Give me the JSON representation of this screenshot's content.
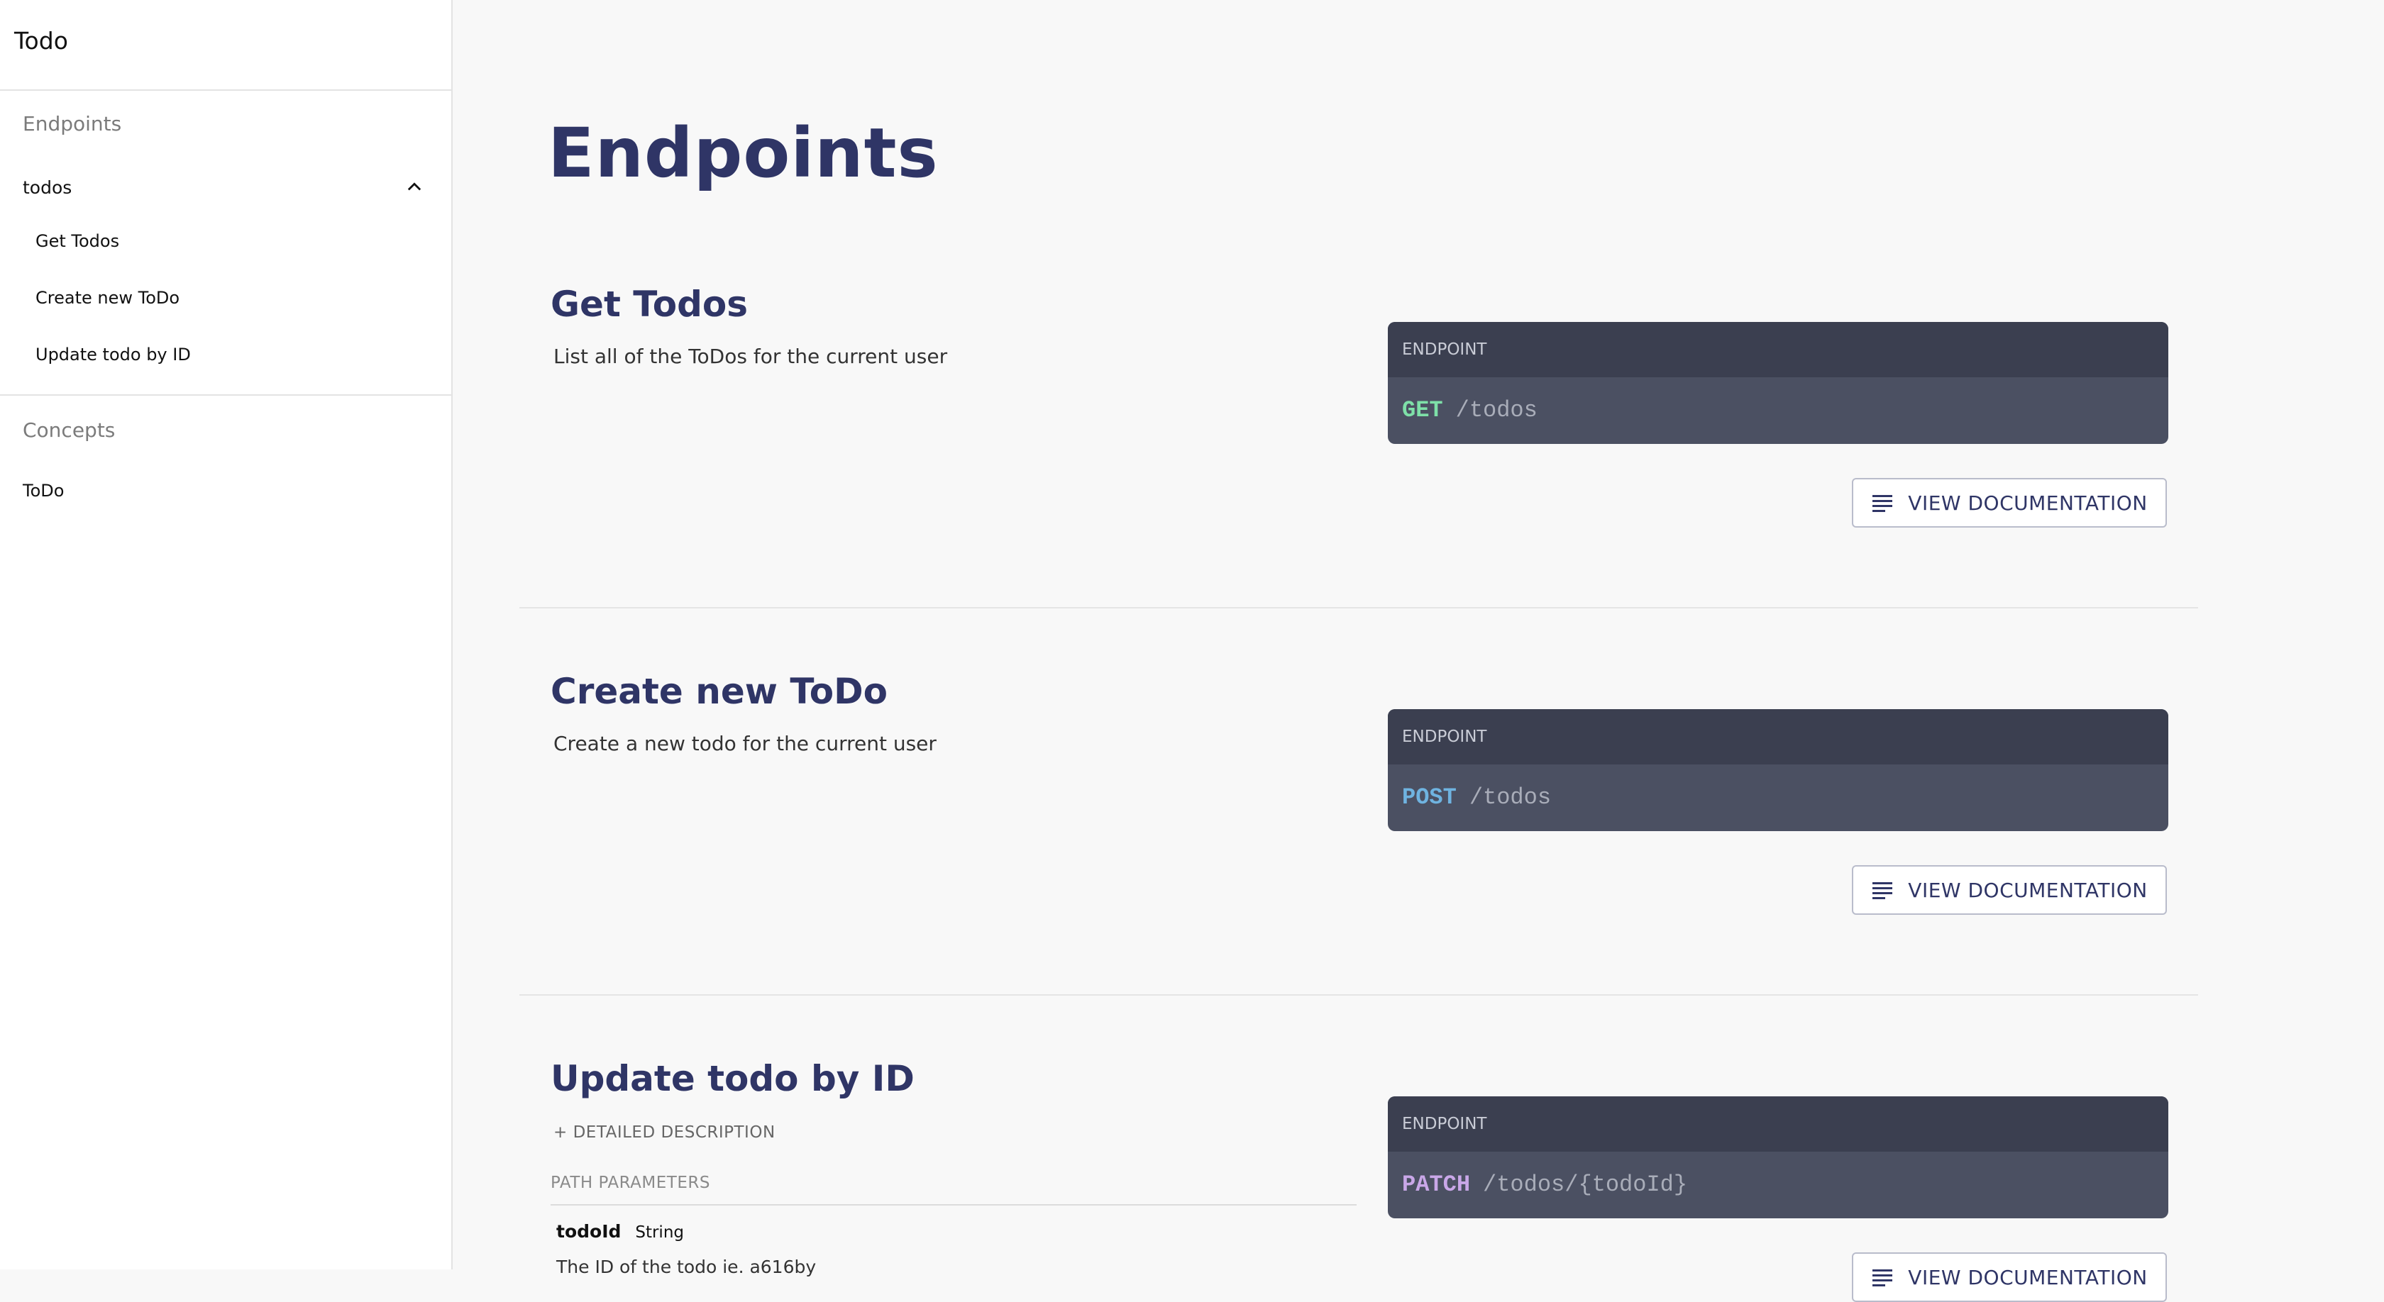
{
  "sidebar": {
    "app_title": "Todo",
    "endpoints_heading": "Endpoints",
    "group_label": "todos",
    "items": [
      {
        "label": "Get Todos"
      },
      {
        "label": "Create new ToDo"
      },
      {
        "label": "Update todo by ID"
      }
    ],
    "concepts_heading": "Concepts",
    "concepts": [
      {
        "label": "ToDo"
      }
    ]
  },
  "main": {
    "page_title": "Endpoints",
    "endpoint_header_label": "ENDPOINT",
    "view_doc_label": "VIEW DOCUMENTATION",
    "endpoints": [
      {
        "title": "Get Todos",
        "description": "List all of the ToDos for the current user",
        "method": "GET",
        "method_color": "#7ee0a8",
        "path": "/todos"
      },
      {
        "title": "Create new ToDo",
        "description": "Create a new todo for the current user",
        "method": "POST",
        "method_color": "#6fb3e0",
        "path": "/todos"
      },
      {
        "title": "Update todo by ID",
        "detail_link": "+ DETAILED DESCRIPTION",
        "method": "PATCH",
        "method_color": "#c9a7e8",
        "path": "/todos/{todoId}",
        "path_params_heading": "PATH PARAMETERS",
        "params": [
          {
            "name": "todoId",
            "type": "String",
            "description": "The ID of the todo ie. a616by"
          }
        ]
      }
    ]
  }
}
